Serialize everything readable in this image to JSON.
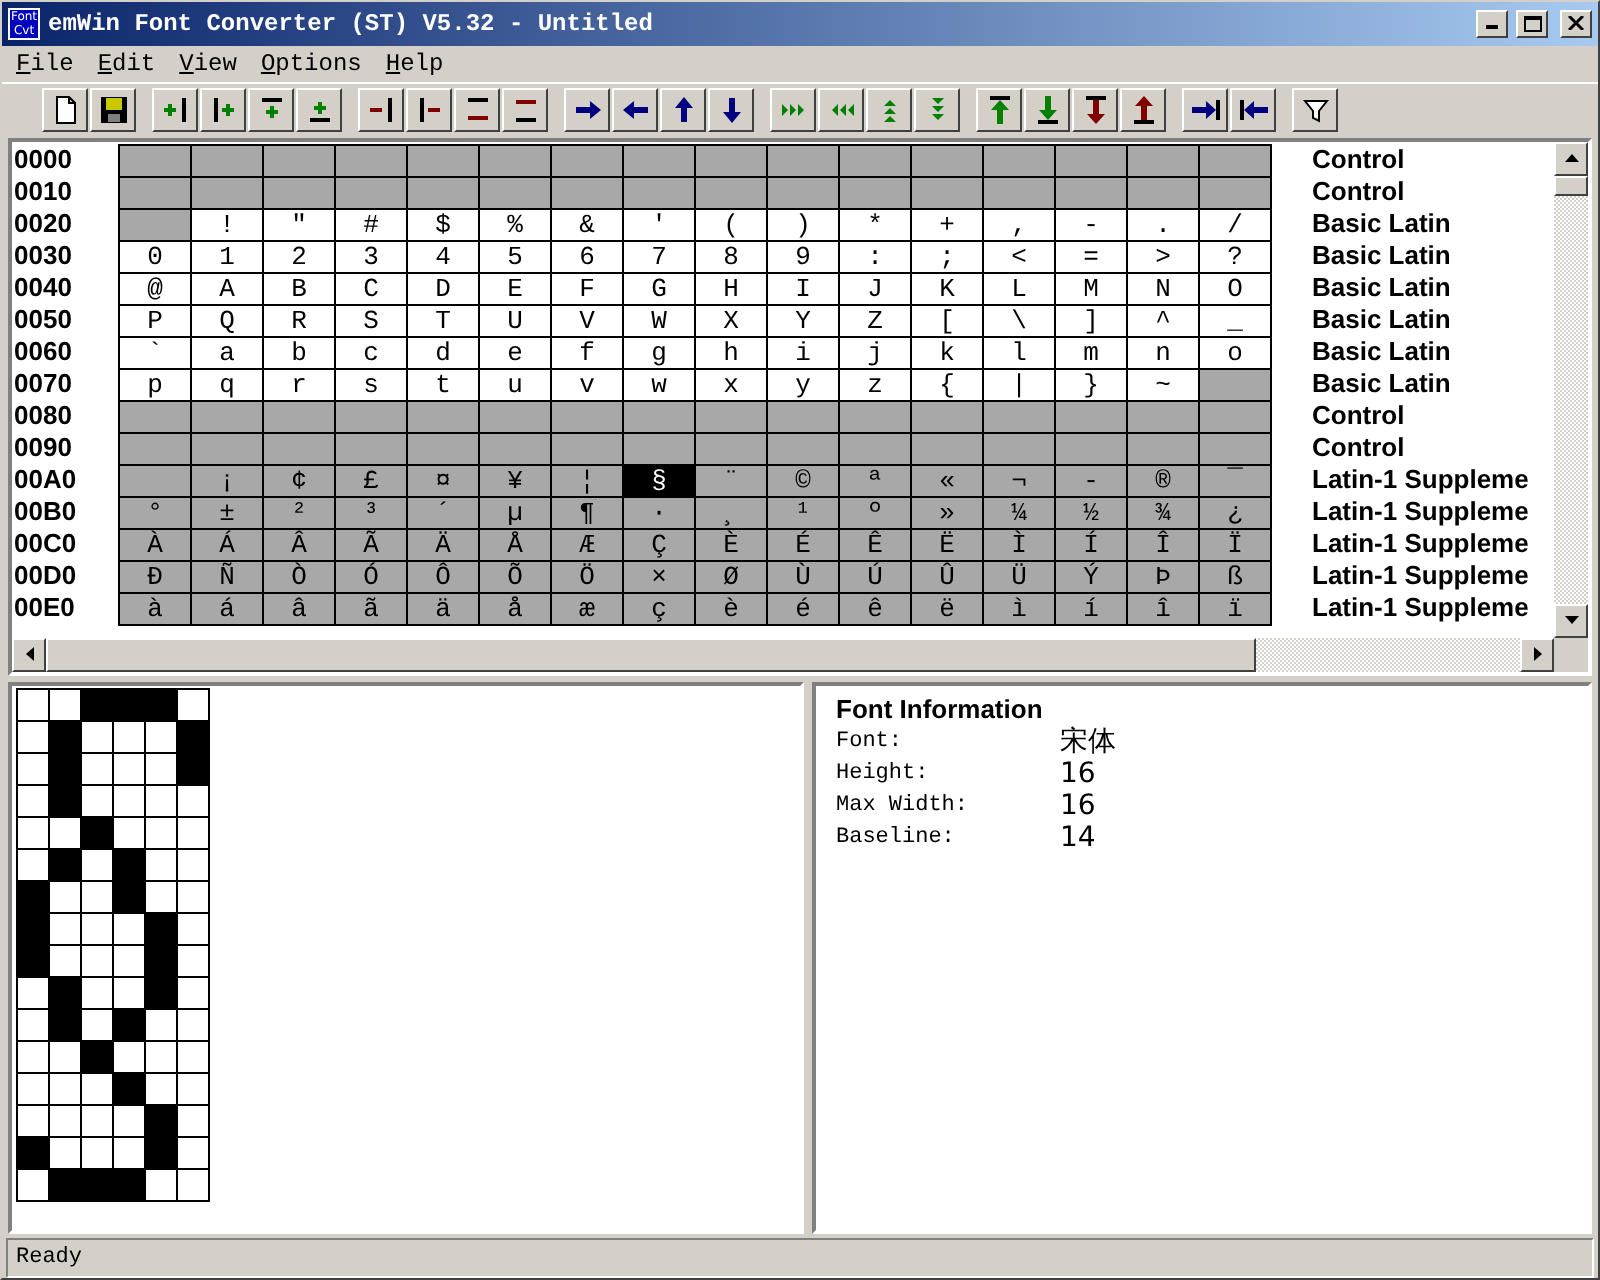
{
  "window": {
    "title": "emWin Font Converter (ST) V5.32 - Untitled",
    "logo": [
      "Font",
      "Cvt"
    ]
  },
  "menu": [
    {
      "label": "File"
    },
    {
      "label": "Edit"
    },
    {
      "label": "View"
    },
    {
      "label": "Options"
    },
    {
      "label": "Help"
    }
  ],
  "char_table": {
    "rows": [
      {
        "code": "0000",
        "block": "Control",
        "cells": [
          {
            "included": false,
            "selected": false
          },
          {
            "included": false,
            "selected": false
          },
          {
            "included": false,
            "selected": false
          },
          {
            "included": false,
            "selected": false
          },
          {
            "included": false,
            "selected": false
          },
          {
            "included": false,
            "selected": false
          },
          {
            "included": false,
            "selected": false
          },
          {
            "included": false,
            "selected": false
          },
          {
            "included": false,
            "selected": false
          },
          {
            "included": false,
            "selected": false
          },
          {
            "included": false,
            "selected": false
          },
          {
            "included": false,
            "selected": false
          },
          {
            "included": false,
            "selected": false
          },
          {
            "included": false,
            "selected": false
          },
          {
            "included": false,
            "selected": false
          },
          {
            "included": false,
            "selected": false
          }
        ]
      },
      {
        "code": "0010",
        "block": "Control",
        "cells": [
          {
            "included": false,
            "selected": false
          },
          {
            "included": false,
            "selected": false
          },
          {
            "included": false,
            "selected": false
          },
          {
            "included": false,
            "selected": false
          },
          {
            "included": false,
            "selected": false
          },
          {
            "included": false,
            "selected": false
          },
          {
            "included": false,
            "selected": false
          },
          {
            "included": false,
            "selected": false
          },
          {
            "included": false,
            "selected": false
          },
          {
            "included": false,
            "selected": false
          },
          {
            "included": false,
            "selected": false
          },
          {
            "included": false,
            "selected": false
          },
          {
            "included": false,
            "selected": false
          },
          {
            "included": false,
            "selected": false
          },
          {
            "included": false,
            "selected": false
          },
          {
            "included": false,
            "selected": false
          }
        ]
      },
      {
        "code": "0020",
        "block": "Basic Latin",
        "cells": [
          {
            "included": false,
            "selected": false
          },
          {
            "char": "!",
            "included": true,
            "selected": false
          },
          {
            "char": "\"",
            "included": true,
            "selected": false
          },
          {
            "char": "#",
            "included": true,
            "selected": false
          },
          {
            "char": "$",
            "included": true,
            "selected": false
          },
          {
            "char": "%",
            "included": true,
            "selected": false
          },
          {
            "char": "&",
            "included": true,
            "selected": false
          },
          {
            "char": "'",
            "included": true,
            "selected": false
          },
          {
            "char": "(",
            "included": true,
            "selected": false
          },
          {
            "char": ")",
            "included": true,
            "selected": false
          },
          {
            "char": "*",
            "included": true,
            "selected": false
          },
          {
            "char": "+",
            "included": true,
            "selected": false
          },
          {
            "char": ",",
            "included": true,
            "selected": false
          },
          {
            "char": "-",
            "included": true,
            "selected": false
          },
          {
            "char": ".",
            "included": true,
            "selected": false
          },
          {
            "char": "/",
            "included": true,
            "selected": false
          }
        ]
      },
      {
        "code": "0030",
        "block": "Basic Latin",
        "cells": [
          {
            "char": "0",
            "included": true,
            "selected": false
          },
          {
            "char": "1",
            "included": true,
            "selected": false
          },
          {
            "char": "2",
            "included": true,
            "selected": false
          },
          {
            "char": "3",
            "included": true,
            "selected": false
          },
          {
            "char": "4",
            "included": true,
            "selected": false
          },
          {
            "char": "5",
            "included": true,
            "selected": false
          },
          {
            "char": "6",
            "included": true,
            "selected": false
          },
          {
            "char": "7",
            "included": true,
            "selected": false
          },
          {
            "char": "8",
            "included": true,
            "selected": false
          },
          {
            "char": "9",
            "included": true,
            "selected": false
          },
          {
            "char": ":",
            "included": true,
            "selected": false
          },
          {
            "char": ";",
            "included": true,
            "selected": false
          },
          {
            "char": "<",
            "included": true,
            "selected": false
          },
          {
            "char": "=",
            "included": true,
            "selected": false
          },
          {
            "char": ">",
            "included": true,
            "selected": false
          },
          {
            "char": "?",
            "included": true,
            "selected": false
          }
        ]
      },
      {
        "code": "0040",
        "block": "Basic Latin",
        "cells": [
          {
            "char": "@",
            "included": true,
            "selected": false
          },
          {
            "char": "A",
            "included": true,
            "selected": false
          },
          {
            "char": "B",
            "included": true,
            "selected": false
          },
          {
            "char": "C",
            "included": true,
            "selected": false
          },
          {
            "char": "D",
            "included": true,
            "selected": false
          },
          {
            "char": "E",
            "included": true,
            "selected": false
          },
          {
            "char": "F",
            "included": true,
            "selected": false
          },
          {
            "char": "G",
            "included": true,
            "selected": false
          },
          {
            "char": "H",
            "included": true,
            "selected": false
          },
          {
            "char": "I",
            "included": true,
            "selected": false
          },
          {
            "char": "J",
            "included": true,
            "selected": false
          },
          {
            "char": "K",
            "included": true,
            "selected": false
          },
          {
            "char": "L",
            "included": true,
            "selected": false
          },
          {
            "char": "M",
            "included": true,
            "selected": false
          },
          {
            "char": "N",
            "included": true,
            "selected": false
          },
          {
            "char": "O",
            "included": true,
            "selected": false
          }
        ]
      },
      {
        "code": "0050",
        "block": "Basic Latin",
        "cells": [
          {
            "char": "P",
            "included": true,
            "selected": false
          },
          {
            "char": "Q",
            "included": true,
            "selected": false
          },
          {
            "char": "R",
            "included": true,
            "selected": false
          },
          {
            "char": "S",
            "included": true,
            "selected": false
          },
          {
            "char": "T",
            "included": true,
            "selected": false
          },
          {
            "char": "U",
            "included": true,
            "selected": false
          },
          {
            "char": "V",
            "included": true,
            "selected": false
          },
          {
            "char": "W",
            "included": true,
            "selected": false
          },
          {
            "char": "X",
            "included": true,
            "selected": false
          },
          {
            "char": "Y",
            "included": true,
            "selected": false
          },
          {
            "char": "Z",
            "included": true,
            "selected": false
          },
          {
            "char": "[",
            "included": true,
            "selected": false
          },
          {
            "char": "\\",
            "included": true,
            "selected": false
          },
          {
            "char": "]",
            "included": true,
            "selected": false
          },
          {
            "char": "^",
            "included": true,
            "selected": false
          },
          {
            "char": "_",
            "included": true,
            "selected": false
          }
        ]
      },
      {
        "code": "0060",
        "block": "Basic Latin",
        "cells": [
          {
            "char": "`",
            "included": true,
            "selected": false
          },
          {
            "char": "a",
            "included": true,
            "selected": false
          },
          {
            "char": "b",
            "included": true,
            "selected": false
          },
          {
            "char": "c",
            "included": true,
            "selected": false
          },
          {
            "char": "d",
            "included": true,
            "selected": false
          },
          {
            "char": "e",
            "included": true,
            "selected": false
          },
          {
            "char": "f",
            "included": true,
            "selected": false
          },
          {
            "char": "g",
            "included": true,
            "selected": false
          },
          {
            "char": "h",
            "included": true,
            "selected": false
          },
          {
            "char": "i",
            "included": true,
            "selected": false
          },
          {
            "char": "j",
            "included": true,
            "selected": false
          },
          {
            "char": "k",
            "included": true,
            "selected": false
          },
          {
            "char": "l",
            "included": true,
            "selected": false
          },
          {
            "char": "m",
            "included": true,
            "selected": false
          },
          {
            "char": "n",
            "included": true,
            "selected": false
          },
          {
            "char": "o",
            "included": true,
            "selected": false
          }
        ]
      },
      {
        "code": "0070",
        "block": "Basic Latin",
        "cells": [
          {
            "char": "p",
            "included": true,
            "selected": false
          },
          {
            "char": "q",
            "included": true,
            "selected": false
          },
          {
            "char": "r",
            "included": true,
            "selected": false
          },
          {
            "char": "s",
            "included": true,
            "selected": false
          },
          {
            "char": "t",
            "included": true,
            "selected": false
          },
          {
            "char": "u",
            "included": true,
            "selected": false
          },
          {
            "char": "v",
            "included": true,
            "selected": false
          },
          {
            "char": "w",
            "included": true,
            "selected": false
          },
          {
            "char": "x",
            "included": true,
            "selected": false
          },
          {
            "char": "y",
            "included": true,
            "selected": false
          },
          {
            "char": "z",
            "included": true,
            "selected": false
          },
          {
            "char": "{",
            "included": true,
            "selected": false
          },
          {
            "char": "|",
            "included": true,
            "selected": false
          },
          {
            "char": "}",
            "included": true,
            "selected": false
          },
          {
            "char": "~",
            "included": true,
            "selected": false
          },
          {
            "included": false,
            "selected": false
          }
        ]
      },
      {
        "code": "0080",
        "block": "Control",
        "cells": [
          {
            "included": false,
            "selected": false
          },
          {
            "included": false,
            "selected": false
          },
          {
            "included": false,
            "selected": false
          },
          {
            "included": false,
            "selected": false
          },
          {
            "included": false,
            "selected": false
          },
          {
            "included": false,
            "selected": false
          },
          {
            "included": false,
            "selected": false
          },
          {
            "included": false,
            "selected": false
          },
          {
            "included": false,
            "selected": false
          },
          {
            "included": false,
            "selected": false
          },
          {
            "included": false,
            "selected": false
          },
          {
            "included": false,
            "selected": false
          },
          {
            "included": false,
            "selected": false
          },
          {
            "included": false,
            "selected": false
          },
          {
            "included": false,
            "selected": false
          },
          {
            "included": false,
            "selected": false
          }
        ]
      },
      {
        "code": "0090",
        "block": "Control",
        "cells": [
          {
            "included": false,
            "selected": false
          },
          {
            "included": false,
            "selected": false
          },
          {
            "included": false,
            "selected": false
          },
          {
            "included": false,
            "selected": false
          },
          {
            "included": false,
            "selected": false
          },
          {
            "included": false,
            "selected": false
          },
          {
            "included": false,
            "selected": false
          },
          {
            "included": false,
            "selected": false
          },
          {
            "included": false,
            "selected": false
          },
          {
            "included": false,
            "selected": false
          },
          {
            "included": false,
            "selected": false
          },
          {
            "included": false,
            "selected": false
          },
          {
            "included": false,
            "selected": false
          },
          {
            "included": false,
            "selected": false
          },
          {
            "included": false,
            "selected": false
          },
          {
            "included": false,
            "selected": false
          }
        ]
      },
      {
        "code": "00A0",
        "block": "Latin-1 Suppleme",
        "cells": [
          {
            "included": false,
            "selected": false
          },
          {
            "char": "¡",
            "included": false,
            "selected": false
          },
          {
            "char": "¢",
            "included": false,
            "selected": false
          },
          {
            "char": "£",
            "included": false,
            "selected": false
          },
          {
            "char": "¤",
            "included": false,
            "selected": false
          },
          {
            "char": "¥",
            "included": false,
            "selected": false
          },
          {
            "char": "¦",
            "included": false,
            "selected": false
          },
          {
            "char": "§",
            "included": false,
            "selected": true
          },
          {
            "char": "¨",
            "included": false,
            "selected": false
          },
          {
            "char": "©",
            "included": false,
            "selected": false
          },
          {
            "char": "ª",
            "included": false,
            "selected": false
          },
          {
            "char": "«",
            "included": false,
            "selected": false
          },
          {
            "char": "¬",
            "included": false,
            "selected": false
          },
          {
            "char": "-",
            "included": false,
            "selected": false
          },
          {
            "char": "®",
            "included": false,
            "selected": false
          },
          {
            "char": "¯",
            "included": false,
            "selected": false
          }
        ]
      },
      {
        "code": "00B0",
        "block": "Latin-1 Suppleme",
        "cells": [
          {
            "char": "°",
            "included": false,
            "selected": false
          },
          {
            "char": "±",
            "included": false,
            "selected": false
          },
          {
            "char": "²",
            "included": false,
            "selected": false
          },
          {
            "char": "³",
            "included": false,
            "selected": false
          },
          {
            "char": "´",
            "included": false,
            "selected": false
          },
          {
            "char": "µ",
            "included": false,
            "selected": false
          },
          {
            "char": "¶",
            "included": false,
            "selected": false
          },
          {
            "char": "·",
            "included": false,
            "selected": false
          },
          {
            "char": "¸",
            "included": false,
            "selected": false
          },
          {
            "char": "¹",
            "included": false,
            "selected": false
          },
          {
            "char": "º",
            "included": false,
            "selected": false
          },
          {
            "char": "»",
            "included": false,
            "selected": false
          },
          {
            "char": "¼",
            "included": false,
            "selected": false
          },
          {
            "char": "½",
            "included": false,
            "selected": false
          },
          {
            "char": "¾",
            "included": false,
            "selected": false
          },
          {
            "char": "¿",
            "included": false,
            "selected": false
          }
        ]
      },
      {
        "code": "00C0",
        "block": "Latin-1 Suppleme",
        "cells": [
          {
            "char": "À",
            "included": false,
            "selected": false
          },
          {
            "char": "Á",
            "included": false,
            "selected": false
          },
          {
            "char": "Â",
            "included": false,
            "selected": false
          },
          {
            "char": "Ã",
            "included": false,
            "selected": false
          },
          {
            "char": "Ä",
            "included": false,
            "selected": false
          },
          {
            "char": "Å",
            "included": false,
            "selected": false
          },
          {
            "char": "Æ",
            "included": false,
            "selected": false
          },
          {
            "char": "Ç",
            "included": false,
            "selected": false
          },
          {
            "char": "È",
            "included": false,
            "selected": false
          },
          {
            "char": "É",
            "included": false,
            "selected": false
          },
          {
            "char": "Ê",
            "included": false,
            "selected": false
          },
          {
            "char": "Ë",
            "included": false,
            "selected": false
          },
          {
            "char": "Ì",
            "included": false,
            "selected": false
          },
          {
            "char": "Í",
            "included": false,
            "selected": false
          },
          {
            "char": "Î",
            "included": false,
            "selected": false
          },
          {
            "char": "Ï",
            "included": false,
            "selected": false
          }
        ]
      },
      {
        "code": "00D0",
        "block": "Latin-1 Suppleme",
        "cells": [
          {
            "char": "Ð",
            "included": false,
            "selected": false
          },
          {
            "char": "Ñ",
            "included": false,
            "selected": false
          },
          {
            "char": "Ò",
            "included": false,
            "selected": false
          },
          {
            "char": "Ó",
            "included": false,
            "selected": false
          },
          {
            "char": "Ô",
            "included": false,
            "selected": false
          },
          {
            "char": "Õ",
            "included": false,
            "selected": false
          },
          {
            "char": "Ö",
            "included": false,
            "selected": false
          },
          {
            "char": "×",
            "included": false,
            "selected": false
          },
          {
            "char": "Ø",
            "included": false,
            "selected": false
          },
          {
            "char": "Ù",
            "included": false,
            "selected": false
          },
          {
            "char": "Ú",
            "included": false,
            "selected": false
          },
          {
            "char": "Û",
            "included": false,
            "selected": false
          },
          {
            "char": "Ü",
            "included": false,
            "selected": false
          },
          {
            "char": "Ý",
            "included": false,
            "selected": false
          },
          {
            "char": "Þ",
            "included": false,
            "selected": false
          },
          {
            "char": "ß",
            "included": false,
            "selected": false
          }
        ]
      },
      {
        "code": "00E0",
        "block": "Latin-1 Suppleme",
        "cells": [
          {
            "char": "à",
            "included": false,
            "selected": false
          },
          {
            "char": "á",
            "included": false,
            "selected": false
          },
          {
            "char": "â",
            "included": false,
            "selected": false
          },
          {
            "char": "ã",
            "included": false,
            "selected": false
          },
          {
            "char": "ä",
            "included": false,
            "selected": false
          },
          {
            "char": "å",
            "included": false,
            "selected": false
          },
          {
            "char": "æ",
            "included": false,
            "selected": false
          },
          {
            "char": "ç",
            "included": false,
            "selected": false
          },
          {
            "char": "è",
            "included": false,
            "selected": false
          },
          {
            "char": "é",
            "included": false,
            "selected": false
          },
          {
            "char": "ê",
            "included": false,
            "selected": false
          },
          {
            "char": "ë",
            "included": false,
            "selected": false
          },
          {
            "char": "ì",
            "included": false,
            "selected": false
          },
          {
            "char": "í",
            "included": false,
            "selected": false
          },
          {
            "char": "î",
            "included": false,
            "selected": false
          },
          {
            "char": "ï",
            "included": false,
            "selected": false
          }
        ]
      }
    ]
  },
  "glyph": {
    "pixels": [
      [
        false,
        false,
        true,
        true,
        true,
        false
      ],
      [
        false,
        true,
        false,
        false,
        false,
        true
      ],
      [
        false,
        true,
        false,
        false,
        false,
        true
      ],
      [
        false,
        true,
        false,
        false,
        false,
        false
      ],
      [
        false,
        false,
        true,
        false,
        false,
        false
      ],
      [
        false,
        true,
        false,
        true,
        false,
        false
      ],
      [
        true,
        false,
        false,
        true,
        false,
        false
      ],
      [
        true,
        false,
        false,
        false,
        true,
        false
      ],
      [
        true,
        false,
        false,
        false,
        true,
        false
      ],
      [
        false,
        true,
        false,
        false,
        true,
        false
      ],
      [
        false,
        true,
        false,
        true,
        false,
        false
      ],
      [
        false,
        false,
        true,
        false,
        false,
        false
      ],
      [
        false,
        false,
        false,
        true,
        false,
        false
      ],
      [
        false,
        false,
        false,
        false,
        true,
        false
      ],
      [
        true,
        false,
        false,
        false,
        true,
        false
      ],
      [
        false,
        true,
        true,
        true,
        false,
        false
      ]
    ]
  },
  "font_info": {
    "heading": "Font Information",
    "fields": [
      {
        "label": "Font:",
        "value": "宋体"
      },
      {
        "label": "Height:",
        "value": "16"
      },
      {
        "label": "Max Width:",
        "value": "16"
      },
      {
        "label": "Baseline:",
        "value": "14"
      }
    ]
  },
  "status_bar": {
    "text": "Ready"
  }
}
